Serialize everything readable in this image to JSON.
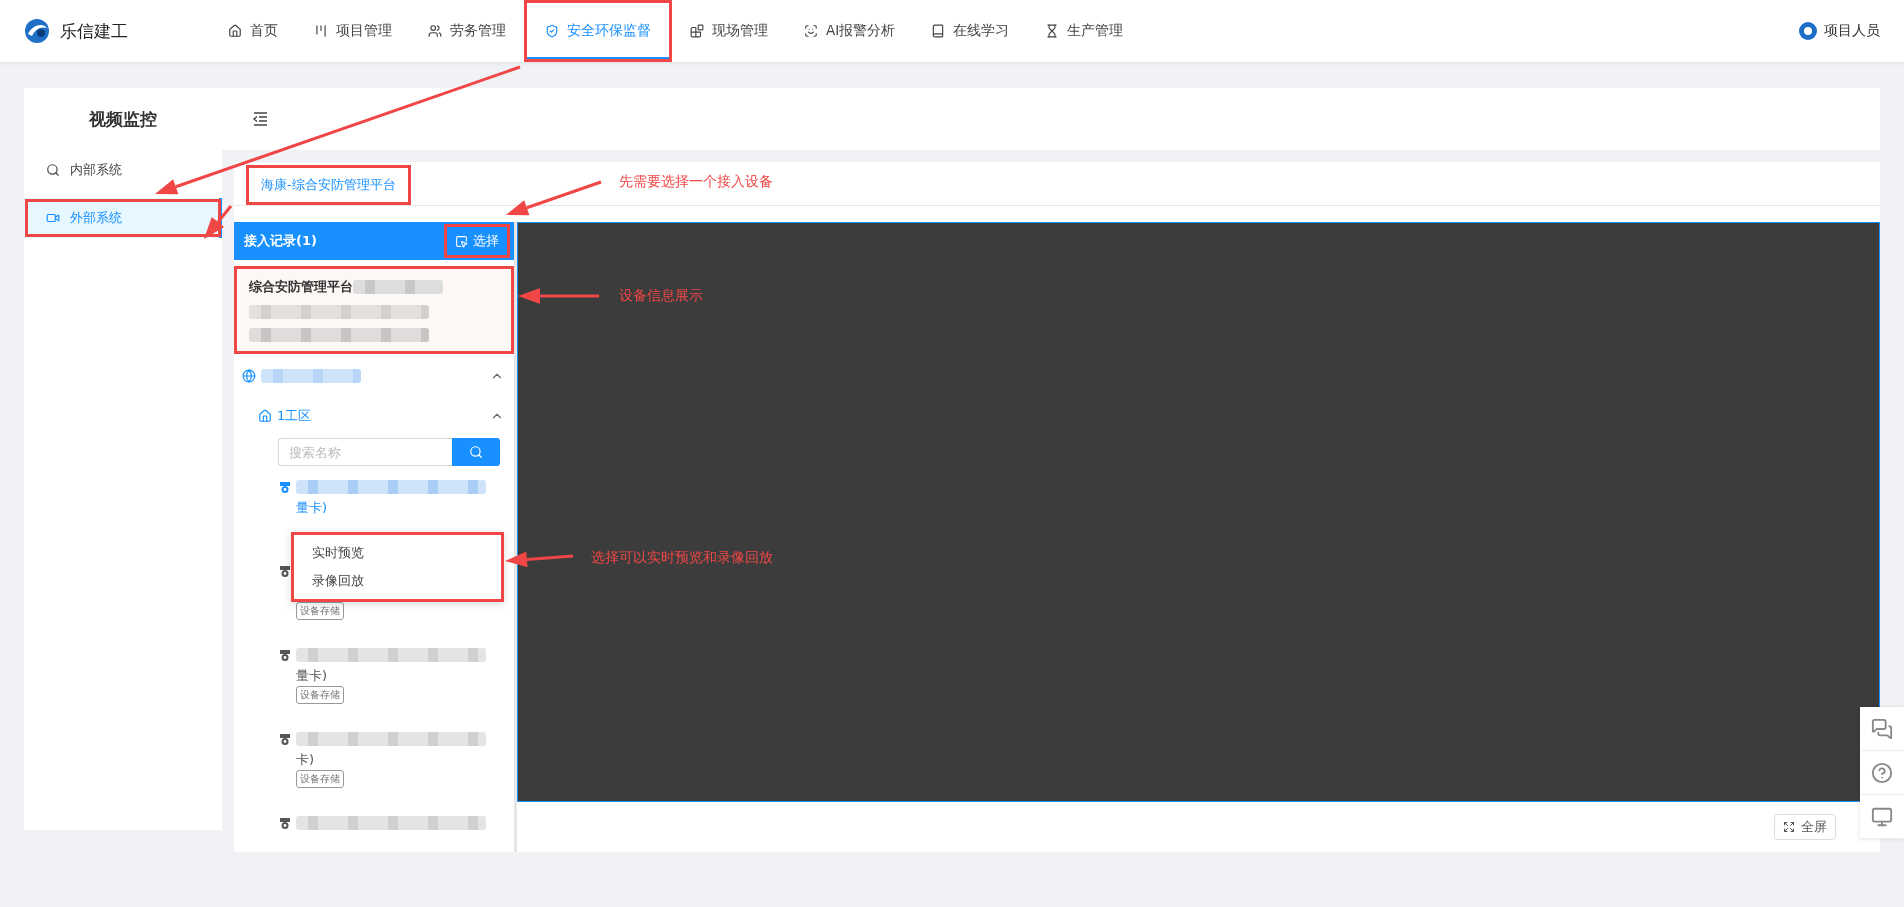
{
  "header": {
    "logo": "乐信建工",
    "nav": [
      {
        "label": "首页",
        "selected": false
      },
      {
        "label": "项目管理",
        "selected": false
      },
      {
        "label": "劳务管理",
        "selected": false
      },
      {
        "label": "安全环保监督",
        "selected": true,
        "highlighted": true
      },
      {
        "label": "现场管理",
        "selected": false
      },
      {
        "label": "AI报警分析",
        "selected": false
      },
      {
        "label": "在线学习",
        "selected": false
      },
      {
        "label": "生产管理",
        "selected": false
      }
    ],
    "user": "项目人员"
  },
  "sidebar": {
    "title": "视频监控",
    "items": [
      {
        "label": "内部系统",
        "selected": false
      },
      {
        "label": "外部系统",
        "selected": true,
        "highlighted": true
      }
    ]
  },
  "tabs": [
    {
      "label": "海康-综合安防管理平台",
      "selected": true,
      "highlighted": true
    }
  ],
  "records": {
    "title": "接入记录(1)",
    "button": {
      "label": "选择",
      "highlighted": true
    },
    "device": {
      "name": "综合安防管理平台",
      "highlighted": true
    }
  },
  "tree": [
    {
      "expanded": true,
      "children": [
        {
          "label": "1工区",
          "expanded": true,
          "search_placeholder": "搜索名称",
          "devices": [
            {
              "selected": true,
              "tail": "量卡)"
            },
            {
              "selected": false,
              "tag": "设备存储"
            },
            {
              "selected": false,
              "tail": "量卡)",
              "tag": "设备存储"
            },
            {
              "selected": false,
              "tail": "卡)",
              "tag": "设备存储"
            },
            {
              "selected": false
            }
          ]
        }
      ]
    }
  ],
  "context_menu": {
    "highlighted": true,
    "items": [
      "实时预览",
      "录像回放"
    ]
  },
  "player": {
    "fullscreen": "全屏"
  },
  "annotations": [
    {
      "text": "先需要选择一个接入设备"
    },
    {
      "text": "设备信息展示"
    },
    {
      "text": "选择可以实时预览和录像回放"
    }
  ]
}
